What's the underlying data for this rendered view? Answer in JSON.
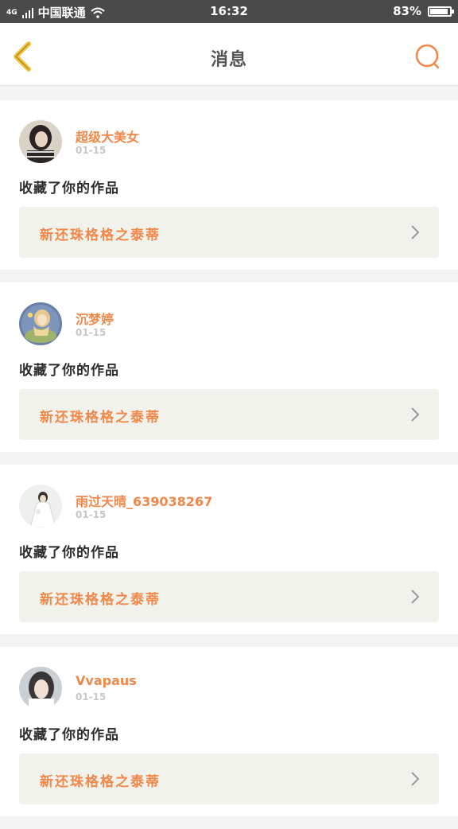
{
  "status_bar": {
    "network": "4G",
    "carrier": "中国联通",
    "time": "16:32",
    "battery": "83%",
    "battery_level": 0.83
  },
  "header": {
    "title": "消息",
    "back_icon": "chevron-left-icon",
    "search_icon": "search-icon",
    "accent_color": "#f0884a"
  },
  "messages": [
    {
      "user": "超级大美女",
      "date": "01-15",
      "action": "收藏了你的作品",
      "work": "新还珠格格之泰蒂"
    },
    {
      "user": "沉梦婷",
      "date": "01-15",
      "action": "收藏了你的作品",
      "work": "新还珠格格之泰蒂"
    },
    {
      "user": "雨过天晴_639038267",
      "date": "01-15",
      "action": "收藏了你的作品",
      "work": "新还珠格格之泰蒂"
    },
    {
      "user": "Vvapaus",
      "date": "01-15",
      "action": "收藏了你的作品",
      "work": "新还珠格格之泰蒂"
    }
  ]
}
